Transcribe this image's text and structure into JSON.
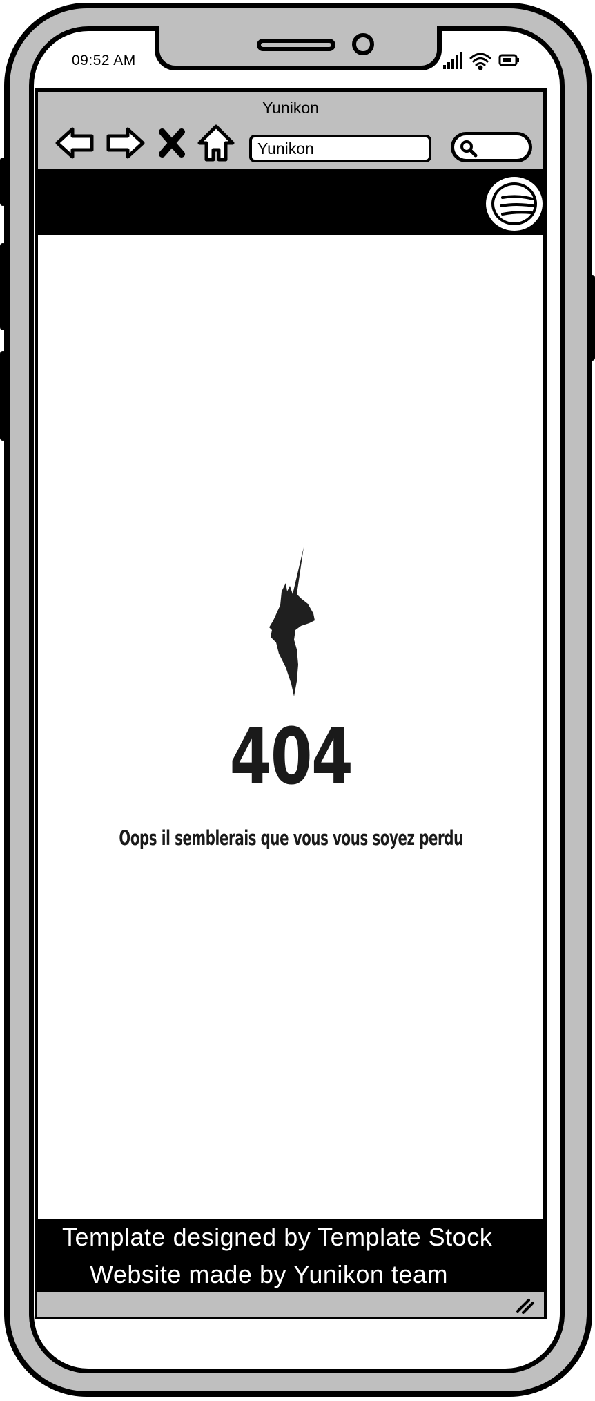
{
  "status_bar": {
    "time": "09:52 AM",
    "icons": [
      "signal-icon",
      "wifi-icon",
      "battery-icon"
    ]
  },
  "browser": {
    "title": "Yunikon",
    "url": "Yunikon",
    "nav_icons": [
      "back-arrow-icon",
      "forward-arrow-icon",
      "close-icon",
      "home-icon"
    ],
    "search_icon": "search-icon"
  },
  "header": {
    "menu_icon": "hamburger-menu-icon"
  },
  "error_page": {
    "logo_icon": "unicorn-logo-icon",
    "code": "404",
    "message": "Oops il semblerais que vous vous soyez perdu"
  },
  "footer": {
    "line1": "Template designed by Template Stock",
    "line2": "Website made by Yunikon team"
  },
  "colors": {
    "frame": "#000000",
    "chrome": "#bfbfbf",
    "background": "#ffffff",
    "text_dark": "#1a1a1a"
  }
}
